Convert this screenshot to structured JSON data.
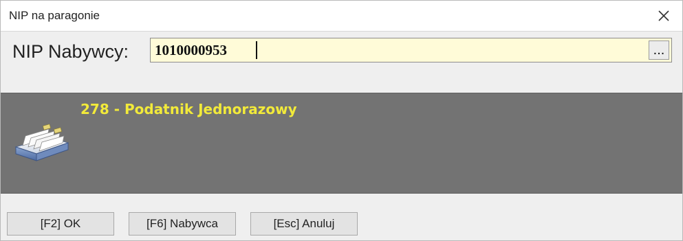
{
  "window": {
    "title": "NIP na paragonie",
    "close_icon": "close-icon"
  },
  "nip": {
    "label": "NIP Nabywcy:",
    "value": "1010000953",
    "lookup_button_label": "..."
  },
  "result": {
    "text": "278 - Podatnik Jednorazowy",
    "icon": "card-file-icon",
    "text_color": "#f2ea3a",
    "panel_color": "#737373"
  },
  "footer": {
    "ok_label": "[F2] OK",
    "buyer_label": "[F6] Nabywca",
    "cancel_label": "[Esc] Anuluj"
  },
  "colors": {
    "input_background": "#fffbd8"
  }
}
